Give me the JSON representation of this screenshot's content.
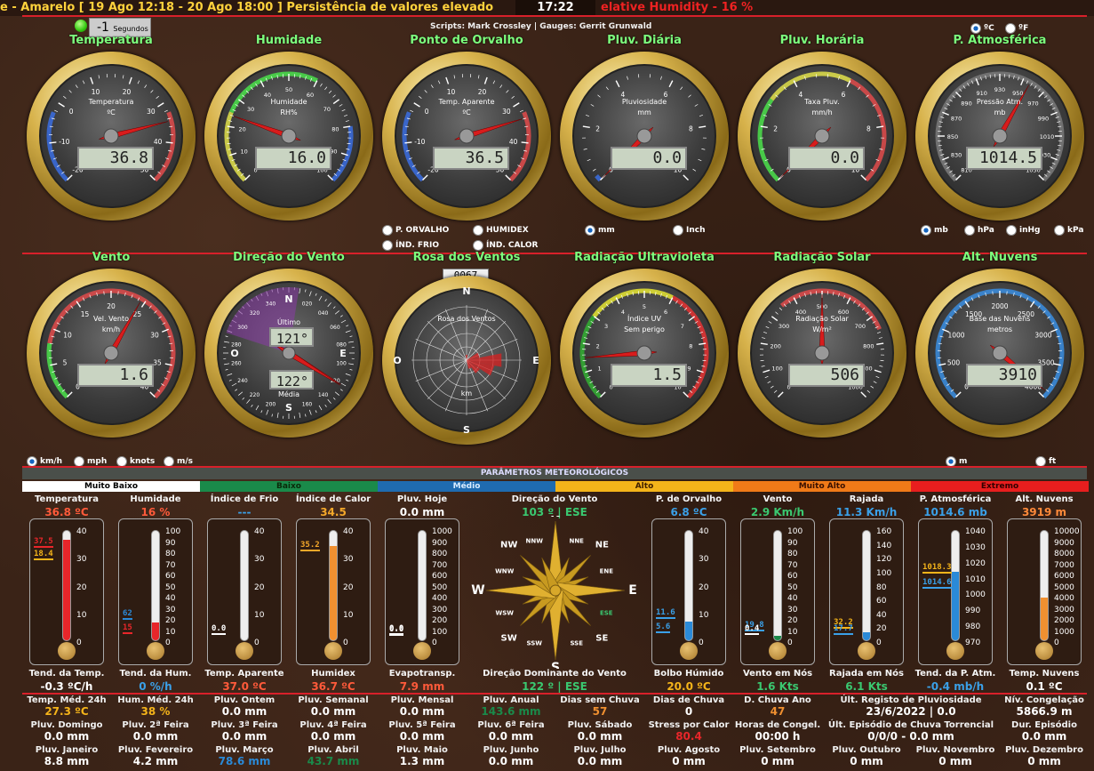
{
  "ticker": {
    "left": "e - Amarelo [ 19 Ago 12:18 - 20 Ago 18:00 ] Persistência de valores elevado",
    "clock": "17:22",
    "right": "elative Humidity - 16 %"
  },
  "timer": {
    "value": "-1",
    "unit": "Segundos"
  },
  "credits": "Scripts: Mark Crossley | Gauges: Gerrit Grunwald",
  "units_temp": [
    "ºC",
    "ºF"
  ],
  "row1": [
    {
      "title": "Temperatura",
      "label": "Temperatura",
      "unit": "ºC",
      "value": "36.8",
      "ticks": [
        "-20",
        "-10",
        "0",
        "10",
        "20",
        "30",
        "40",
        "50"
      ]
    },
    {
      "title": "Humidade",
      "label": "Humidade",
      "unit": "RH%",
      "value": "16.0",
      "ticks": [
        "0",
        "10",
        "20",
        "30",
        "40",
        "50",
        "60",
        "70",
        "80",
        "90",
        "100"
      ]
    },
    {
      "title": "Ponto de Orvalho",
      "label": "Temp. Aparente",
      "unit": "ºC",
      "value": "36.5",
      "ticks": [
        "-20",
        "-10",
        "0",
        "10",
        "20",
        "30",
        "40",
        "50"
      ]
    },
    {
      "title": "Pluv. Diária",
      "label": "Pluviosidade",
      "unit": "mm",
      "value": "0.0",
      "ticks": [
        "0",
        "2",
        "4",
        "6",
        "8",
        "10"
      ]
    },
    {
      "title": "Pluv. Horária",
      "label": "Taxa Pluv.",
      "unit": "mm/h",
      "value": "0.0",
      "ticks": [
        "0",
        "2",
        "4",
        "6",
        "8",
        "10"
      ]
    },
    {
      "title": "P. Atmosférica",
      "label": "Pressão Atm.",
      "unit": "mb",
      "value": "1014.5",
      "ticks": [
        "810",
        "830",
        "850",
        "870",
        "890",
        "910",
        "930",
        "950",
        "970",
        "990",
        "1010",
        "1030",
        "1050"
      ]
    }
  ],
  "dew_options": [
    "P. ORVALHO",
    "HUMIDEX",
    "ÍND. FRIO",
    "ÍND. CALOR"
  ],
  "rain_units": [
    "mm",
    "Inch"
  ],
  "press_units": [
    "mb",
    "hPa",
    "inHg",
    "kPa"
  ],
  "row2": [
    {
      "title": "Vento",
      "label": "Vel. Vento",
      "unit": "km/h",
      "value": "1.6",
      "ticks": [
        "0",
        "5",
        "10",
        "15",
        "20",
        "25",
        "30",
        "35",
        "40"
      ]
    },
    {
      "title": "Direção do Vento",
      "label": "Último",
      "label2": "Média",
      "value": "121°",
      "value2": "122°"
    },
    {
      "title": "Rosa dos Ventos",
      "label": "Rosa dos Ventos",
      "unit": "km",
      "odometer": "0067"
    },
    {
      "title": "Radiação Ultravioleta",
      "label": "Índice UV",
      "unit": "Sem perigo",
      "value": "1.5",
      "ticks": [
        "0",
        "1",
        "2",
        "3",
        "4",
        "5",
        "6",
        "7",
        "8",
        "9",
        "10"
      ]
    },
    {
      "title": "Radiação Solar",
      "label": "Radiação Solar",
      "unit": "W/m²",
      "value": "506",
      "ticks": [
        "0",
        "100",
        "200",
        "300",
        "400",
        "500",
        "600",
        "700",
        "800",
        "900",
        "1000"
      ]
    },
    {
      "title": "Alt. Nuvens",
      "label": "Base das Nuvens",
      "unit": "metros",
      "value": "3910",
      "ticks": [
        "0",
        "500",
        "1000",
        "1500",
        "2000",
        "2500",
        "3000",
        "3500",
        "4000"
      ]
    }
  ],
  "wind_units": [
    "km/h",
    "mph",
    "knots",
    "m/s"
  ],
  "cloud_units": [
    "m",
    "ft"
  ],
  "section_title": "PARÂMETROS METEOROLÓGICOS",
  "scale": [
    {
      "label": "Muito Baixo",
      "bg": "#ffffff",
      "fg": "#000000"
    },
    {
      "label": "Baixo",
      "bg": "#1a8a4a",
      "fg": "#0a2a0a"
    },
    {
      "label": "Médio",
      "bg": "#1f6bb0",
      "fg": "#d8ecff"
    },
    {
      "label": "Alto",
      "bg": "#f4b41a",
      "fg": "#402000"
    },
    {
      "label": "Muito Alto",
      "bg": "#f07a18",
      "fg": "#3a1000"
    },
    {
      "label": "Extremo",
      "bg": "#e81e1e",
      "fg": "#300000"
    }
  ],
  "thermos": [
    {
      "name": "Temperatura",
      "value": "36.8 ºC",
      "color": "#ff5a3a",
      "fill": "#e8262a",
      "pct": 0.92,
      "hi": "37.5",
      "lo": "18.4",
      "hicol": "#e8262a",
      "locol": "#f4b41a",
      "bottom_name": "Tend. da Temp.",
      "bottom_val": "-0.3 ºC/h",
      "bvcol": "#ffffff",
      "ticks": [
        "40",
        "30",
        "20",
        "10",
        "0"
      ]
    },
    {
      "name": "Humidade",
      "value": "16 %",
      "color": "#ff5a3a",
      "fill": "#e8262a",
      "pct": 0.16,
      "hi": "62",
      "lo": "15",
      "hicol": "#2a8ad8",
      "locol": "#e8262a",
      "bottom_name": "Tend. da Hum.",
      "bottom_val": "0 %/h",
      "bvcol": "#3aa0e8",
      "ticks": [
        "100",
        "90",
        "80",
        "70",
        "60",
        "50",
        "40",
        "30",
        "20",
        "10",
        "0"
      ]
    },
    {
      "name": "Índice de Frio",
      "value": "---",
      "color": "#3aa0e8",
      "fill": "#ffffff",
      "pct": 0.0,
      "hi": "",
      "lo": "0.0",
      "hicol": "#fff",
      "locol": "#ffffff",
      "bottom_name": "Temp. Aparente",
      "bottom_val": "37.0 ºC",
      "bvcol": "#ff5a3a",
      "ticks": [
        "40",
        "30",
        "20",
        "10",
        "0"
      ]
    },
    {
      "name": "Índice de Calor",
      "value": "34.5",
      "color": "#f4a82a",
      "fill": "#f09030",
      "pct": 0.86,
      "hi": "35.2",
      "lo": "",
      "hicol": "#f4a82a",
      "locol": "#fff",
      "bottom_name": "Humidex",
      "bottom_val": "36.7 ºC",
      "bvcol": "#ff5a3a",
      "ticks": [
        "40",
        "30",
        "20",
        "10",
        "0"
      ]
    },
    {
      "name": "Pluv. Hoje",
      "value": "0.0 mm",
      "color": "#ffffff",
      "fill": "#ffffff",
      "pct": 0.0,
      "hi": "0.0",
      "lo": "0.0",
      "hicol": "#fff",
      "locol": "#fff",
      "bottom_name": "Evapotransp.",
      "bottom_val": "7.9 mm",
      "bvcol": "#ff5a3a",
      "ticks": [
        "1000",
        "900",
        "800",
        "700",
        "600",
        "500",
        "400",
        "300",
        "200",
        "100",
        "0"
      ]
    },
    {
      "name": "P. de Orvalho",
      "value": "6.8 ºC",
      "color": "#3aa0e8",
      "fill": "#2a8ad8",
      "pct": 0.17,
      "hi": "11.6",
      "lo": "5.6",
      "hicol": "#3aa0e8",
      "locol": "#3aa0e8",
      "bottom_name": "Bolbo Húmido",
      "bottom_val": "20.0 ºC",
      "bvcol": "#f4b41a",
      "ticks": [
        "40",
        "30",
        "20",
        "10",
        "0"
      ]
    },
    {
      "name": "Vento",
      "value": "2.9 Km/h",
      "color": "#3ac870",
      "fill": "#1a8a4a",
      "pct": 0.04,
      "hi": "19.8",
      "lo": "0.4",
      "hicol": "#3aa0e8",
      "locol": "#ffffff",
      "bottom_name": "Vento em Nós",
      "bottom_val": "1.6 Kts",
      "bvcol": "#3ac870",
      "ticks": [
        "100",
        "90",
        "80",
        "70",
        "60",
        "50",
        "40",
        "30",
        "20",
        "10",
        "0"
      ]
    },
    {
      "name": "Rajada",
      "value": "11.3 Km/h",
      "color": "#3aa0e8",
      "fill": "#2a8ad8",
      "pct": 0.07,
      "hi": "32.2",
      "lo": "17.7",
      "hicol": "#f4b41a",
      "locol": "#3aa0e8",
      "bottom_name": "Rajada em Nós",
      "bottom_val": "6.1 Kts",
      "bvcol": "#3ac870",
      "ticks": [
        "160",
        "140",
        "120",
        "100",
        "80",
        "60",
        "40",
        "20",
        "0"
      ]
    },
    {
      "name": "P. Atmosférica",
      "value": "1014.6 mb",
      "color": "#3aa0e8",
      "fill": "#2a8ad8",
      "pct": 0.63,
      "hi": "1018.3",
      "lo": "1014.6",
      "hicol": "#f4b41a",
      "locol": "#3aa0e8",
      "bottom_name": "Tend. da P. Atm.",
      "bottom_val": "-0.4 mb/h",
      "bvcol": "#3aa0e8",
      "ticks": [
        "1040",
        "1030",
        "1020",
        "1010",
        "1000",
        "990",
        "980",
        "970"
      ]
    },
    {
      "name": "Alt. Nuvens",
      "value": "3919 m",
      "color": "#ff8a3a",
      "fill": "#f09030",
      "pct": 0.39,
      "hi": "",
      "lo": "",
      "hicol": "#fff",
      "locol": "#fff",
      "bottom_name": "Temp. Nuvens",
      "bottom_val": "0.1 ºC",
      "bvcol": "#ffffff",
      "ticks": [
        "10000",
        "9000",
        "8000",
        "7000",
        "6000",
        "5000",
        "4000",
        "3000",
        "2000",
        "1000",
        "0"
      ]
    }
  ],
  "compass": {
    "title": "Direção do Vento",
    "value": "103 º | ESE",
    "bottom_title": "Direção Dominante do Vento",
    "bottom_value": "122 º | ESE",
    "points": [
      "N",
      "NNE",
      "NE",
      "ENE",
      "E",
      "ESE",
      "SE",
      "SSE",
      "S",
      "SSW",
      "SW",
      "WSW",
      "W",
      "WNW",
      "NW",
      "NNW"
    ]
  },
  "stats": [
    [
      {
        "l": "Temp. Méd. 24h",
        "v": "27.3 ºC",
        "c": "#f4b41a"
      },
      {
        "l": "Hum. Méd. 24h",
        "v": "38 %",
        "c": "#f4b41a"
      },
      {
        "l": "Pluv. Ontem",
        "v": "0.0 mm",
        "c": "#fff"
      },
      {
        "l": "Pluv. Semanal",
        "v": "0.0 mm",
        "c": "#fff"
      },
      {
        "l": "Pluv. Mensal",
        "v": "0.0 mm",
        "c": "#fff"
      },
      {
        "l": "Pluv. Anual",
        "v": "143.6 mm",
        "c": "#1a8a4a"
      },
      {
        "l": "Dias sem Chuva",
        "v": "57",
        "c": "#f09030"
      },
      {
        "l": "Dias de Chuva",
        "v": "0",
        "c": "#fff"
      },
      {
        "l": "D. Chuva Ano",
        "v": "47",
        "c": "#f09030"
      },
      {
        "l": "Últ. Registo de Pluviosidade",
        "v": "23/6/2022 | 0.0",
        "c": "#fff"
      },
      {
        "l": "Nív. Congelação",
        "v": "5866.9 m",
        "c": "#fff"
      }
    ],
    [
      {
        "l": "Pluv. Domingo",
        "v": "0.0 mm",
        "c": "#fff"
      },
      {
        "l": "Pluv. 2ª Feira",
        "v": "0.0 mm",
        "c": "#fff"
      },
      {
        "l": "Pluv. 3ª Feira",
        "v": "0.0 mm",
        "c": "#fff"
      },
      {
        "l": "Pluv. 4ª Feira",
        "v": "0.0 mm",
        "c": "#fff"
      },
      {
        "l": "Pluv. 5ª Feira",
        "v": "0.0 mm",
        "c": "#fff"
      },
      {
        "l": "Pluv. 6ª Feira",
        "v": "0.0 mm",
        "c": "#fff"
      },
      {
        "l": "Pluv. Sábado",
        "v": "0.0 mm",
        "c": "#fff"
      },
      {
        "l": "Stress por Calor",
        "v": "80.4",
        "c": "#e8262a"
      },
      {
        "l": "Horas de Congel.",
        "v": "00:00 h",
        "c": "#fff"
      },
      {
        "l": "Últ. Episódio de Chuva Torrencial",
        "v": "0/0/0 - 0.0 mm",
        "c": "#fff"
      },
      {
        "l": "Dur. Episódio",
        "v": "0.0 mm",
        "c": "#fff"
      }
    ],
    [
      {
        "l": "Pluv. Janeiro",
        "v": "8.8 mm",
        "c": "#fff"
      },
      {
        "l": "Pluv. Fevereiro",
        "v": "4.2 mm",
        "c": "#fff"
      },
      {
        "l": "Pluv. Março",
        "v": "78.6 mm",
        "c": "#2a8ad8"
      },
      {
        "l": "Pluv. Abril",
        "v": "43.7 mm",
        "c": "#1a8a4a"
      },
      {
        "l": "Pluv. Maio",
        "v": "1.3 mm",
        "c": "#fff"
      },
      {
        "l": "Pluv. Junho",
        "v": "0.0 mm",
        "c": "#fff"
      },
      {
        "l": "Pluv. Julho",
        "v": "0.0 mm",
        "c": "#fff"
      },
      {
        "l": "Pluv. Agosto",
        "v": "0 mm",
        "c": "#fff"
      },
      {
        "l": "Pluv. Setembro",
        "v": "0 mm",
        "c": "#fff"
      },
      {
        "l": "Pluv. Outubro",
        "v": "0 mm",
        "c": "#fff"
      },
      {
        "l": "Pluv. Novembro",
        "v": "0 mm",
        "c": "#fff"
      },
      {
        "l": "Pluv. Dezembro",
        "v": "0 mm",
        "c": "#fff"
      }
    ]
  ]
}
